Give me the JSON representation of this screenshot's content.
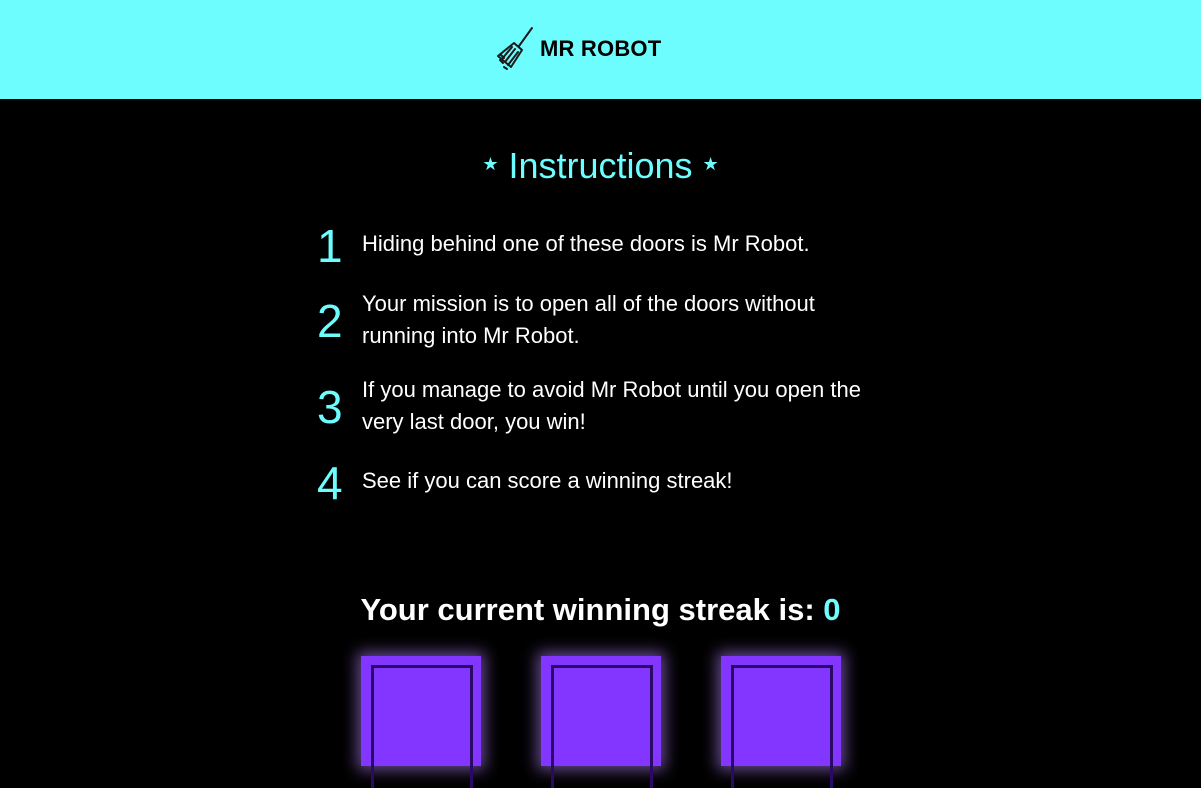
{
  "header": {
    "brand": "MR ROBOT",
    "logo_icon": "broom-icon",
    "background_color": "#6dfdfe"
  },
  "instructions": {
    "title": "Instructions",
    "star": "★",
    "steps": [
      {
        "number": "1",
        "text": "Hiding behind one of these doors is Mr Robot."
      },
      {
        "number": "2",
        "text": "Your mission is to open all of the doors without running into Mr Robot."
      },
      {
        "number": "3",
        "text": "If you manage to avoid Mr Robot until you open the very last door, you win!"
      },
      {
        "number": "4",
        "text": "See if you can score a winning streak!"
      }
    ]
  },
  "streak": {
    "label": "Your current winning streak is: ",
    "value": "0"
  },
  "doors": {
    "count": 3,
    "color": "#8236ff",
    "frame_color": "#2a0a66"
  },
  "colors": {
    "accent": "#6dfdfe",
    "background": "#000000",
    "text": "#ffffff"
  }
}
